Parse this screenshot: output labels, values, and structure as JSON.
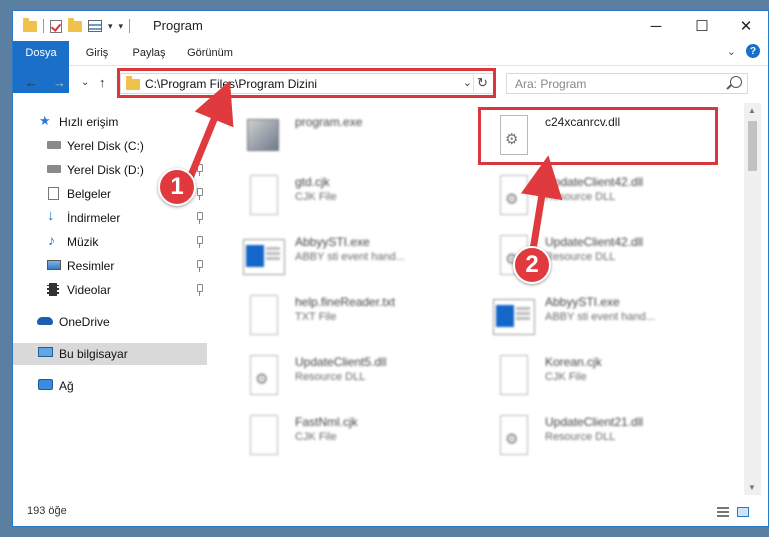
{
  "window": {
    "title": "Program",
    "buttons": {
      "minimize": "─",
      "maximize": "☐",
      "close": "✕"
    }
  },
  "ribbon": {
    "tabs": [
      "Dosya",
      "Giriş",
      "Paylaş",
      "Görünüm"
    ],
    "expand": "⌄",
    "help": "?"
  },
  "nav": {
    "back": "←",
    "forward": "→",
    "recent": "⌄",
    "up": "↑",
    "address": "C:\\Program Files\\Program Dizini",
    "address_chevron": "⌄",
    "refresh": "↻",
    "search_placeholder": "Ara: Program"
  },
  "sidebar": {
    "items": [
      {
        "label": "Hızlı erişim",
        "icon": "star-icon",
        "color": "#2b7ad6"
      },
      {
        "label": "Yerel Disk (C:)",
        "icon": "drive-icon"
      },
      {
        "label": "Yerel Disk (D:)",
        "icon": "drive-icon"
      },
      {
        "label": "Belgeler",
        "icon": "documents-icon"
      },
      {
        "label": "İndirmeler",
        "icon": "download-icon"
      },
      {
        "label": "Müzik",
        "icon": "music-icon"
      },
      {
        "label": "Resimler",
        "icon": "pictures-icon"
      },
      {
        "label": "Videolar",
        "icon": "video-icon"
      },
      {
        "label": "OneDrive",
        "icon": "cloud-icon"
      },
      {
        "label": "Bu bilgisayar",
        "icon": "computer-icon",
        "selected": true
      },
      {
        "label": "Ağ",
        "icon": "network-icon"
      }
    ]
  },
  "files": [
    {
      "name": "program.exe",
      "type": "",
      "kind": "installer"
    },
    {
      "name": "c24xcanrcv.dll",
      "type": "",
      "kind": "dll"
    },
    {
      "name": "gtd.cjk",
      "type": "CJK File",
      "kind": "doc"
    },
    {
      "name": "UpdateClient42.dll",
      "type": "Resource DLL",
      "kind": "dll"
    },
    {
      "name": "AbbyySTI.exe",
      "type": "ABBY sti event hand...",
      "kind": "exe"
    },
    {
      "name": "UpdateClient42.dll",
      "type": "Resource DLL",
      "kind": "dll"
    },
    {
      "name": "help.fineReader.txt",
      "type": "TXT File",
      "kind": "doc"
    },
    {
      "name": "AbbyySTI.exe",
      "type": "ABBY sti event hand...",
      "kind": "exe"
    },
    {
      "name": "UpdateClient5.dll",
      "type": "Resource DLL",
      "kind": "dll"
    },
    {
      "name": "Korean.cjk",
      "type": "CJK File",
      "kind": "doc"
    },
    {
      "name": "FastNml.cjk",
      "type": "CJK File",
      "kind": "doc"
    },
    {
      "name": "UpdateClient21.dll",
      "type": "Resource DLL",
      "kind": "dll"
    }
  ],
  "status": {
    "count": "193 öğe"
  },
  "annotations": {
    "badge1": "1",
    "badge2": "2",
    "color": "#d9363e"
  }
}
